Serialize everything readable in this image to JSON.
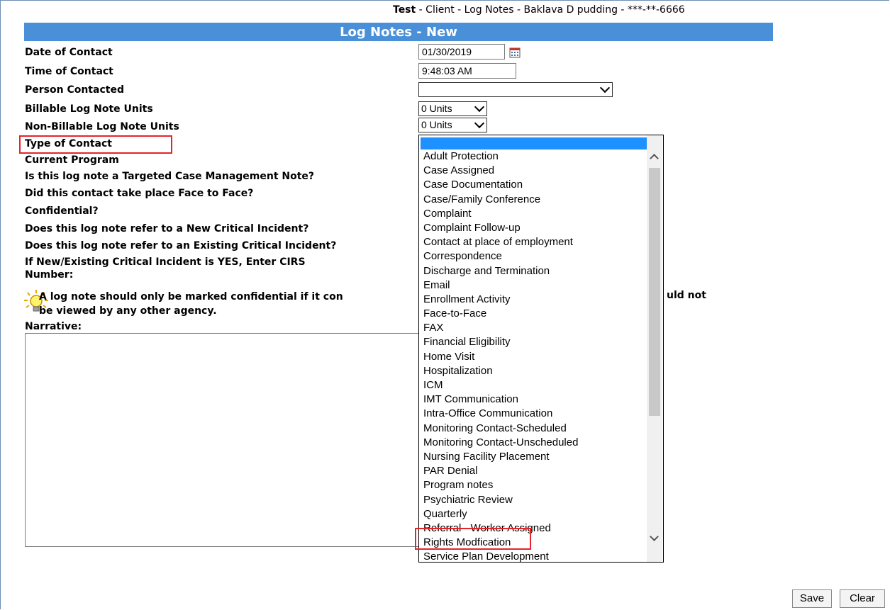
{
  "header": {
    "bold": "Test",
    "rest": " - Client - Log Notes - Baklava D pudding - ***-**-6666"
  },
  "form": {
    "title": "Log Notes - New",
    "labels": {
      "date_of_contact": "Date of Contact",
      "time_of_contact": "Time of Contact",
      "person_contacted": "Person Contacted",
      "billable_units": "Billable Log Note Units",
      "non_billable_units": "Non-Billable Log Note Units",
      "type_of_contact": "Type of Contact",
      "current_program": "Current Program",
      "tcm_note": "Is this log note a Targeted Case Management Note?",
      "face_to_face": "Did this contact take place Face to Face?",
      "confidential": "Confidential?",
      "new_critical": "Does this log note refer to a New Critical Incident?",
      "existing_critical": "Does this log note refer to an Existing Critical Incident?",
      "cirs_line1": "If New/Existing Critical Incident is YES, Enter CIRS",
      "cirs_line2": "Number:",
      "narrative": "Narrative:"
    },
    "values": {
      "date": "01/30/2019",
      "time": "9:48:03 AM",
      "person": "",
      "billable": "0 Units",
      "non_billable": "0 Units"
    },
    "tip": {
      "line1": "A log note should only be marked confidential if it con",
      "line1_right": "uld not",
      "line2": "be viewed by any other agency."
    }
  },
  "dropdown": {
    "options": [
      "Adult Protection",
      "Case Assigned",
      "Case Documentation",
      "Case/Family Conference",
      "Complaint",
      "Complaint Follow-up",
      "Contact at place of employment",
      "Correspondence",
      "Discharge and Termination",
      "Email",
      "Enrollment Activity",
      "Face-to-Face",
      "FAX",
      "Financial Eligibility",
      "Home Visit",
      "Hospitalization",
      "ICM",
      "IMT Communication",
      "Intra-Office Communication",
      "Monitoring Contact-Scheduled",
      "Monitoring Contact-Unscheduled",
      "Nursing Facility Placement",
      "PAR Denial",
      "Program notes",
      "Psychiatric Review",
      "Quarterly",
      "Referral - Worker Assigned",
      "Rights Modfication",
      "Service Plan Development"
    ],
    "highlighted": "Rights Modfication"
  },
  "buttons": {
    "save": "Save",
    "clear": "Clear"
  },
  "colors": {
    "banner": "#4a90d9",
    "highlight_box": "#e3242b",
    "selected_row": "#1e90ff"
  }
}
